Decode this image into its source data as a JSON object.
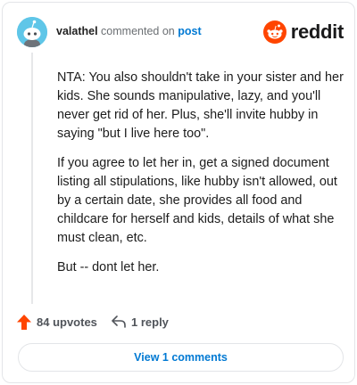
{
  "header": {
    "username": "valathel",
    "verb": "commented on",
    "post_link": "post",
    "brand_name": "reddit"
  },
  "comment": {
    "paragraphs": [
      "NTA: You also shouldn't take in your sister and her kids. She sounds manipulative, lazy, and you'll never get rid of her. Plus, she'll invite hubby in saying \"but I live here too\".",
      "If you agree to let her in, get a signed document listing all stipulations, like hubby isn't allowed, out by a certain date, she provides all food and childcare for herself and kids, details of what she must clean, etc.",
      "But -- dont let her."
    ]
  },
  "actions": {
    "upvotes_label": "84 upvotes",
    "reply_label": "1 reply",
    "view_comments_label": "View 1 comments"
  },
  "colors": {
    "upvote": "#ff4500",
    "link": "#0079d3",
    "reddit_orange": "#ff4500",
    "avatar_bg": "#5fc6e8"
  },
  "icons": {
    "brand": "reddit-logo-icon",
    "upvote": "upvote-arrow-icon",
    "reply": "reply-arrow-icon"
  }
}
